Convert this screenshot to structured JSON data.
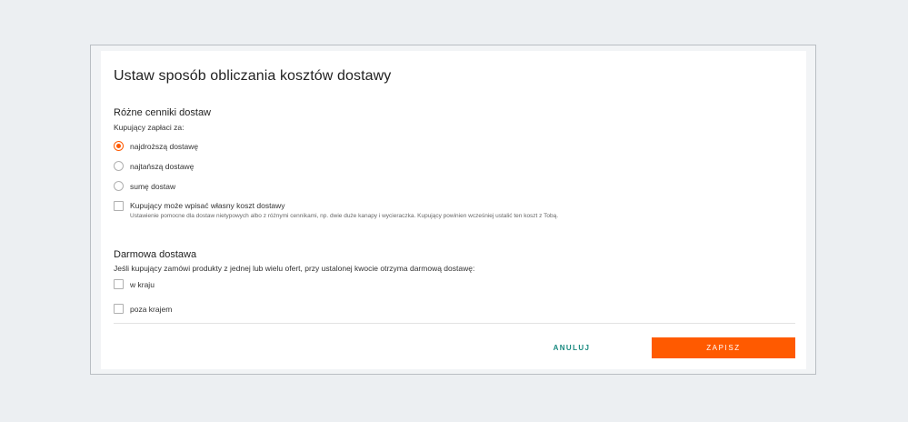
{
  "dialog": {
    "title": "Ustaw sposób obliczania kosztów dostawy"
  },
  "pricing": {
    "heading": "Różne cenniki dostaw",
    "subheading": "Kupujący zapłaci za:",
    "options": [
      {
        "label": "najdroższą dostawę",
        "selected": true
      },
      {
        "label": "najtańszą dostawę",
        "selected": false
      },
      {
        "label": "sumę dostaw",
        "selected": false
      }
    ],
    "custom_cost": {
      "label": "Kupujący może wpisać własny koszt dostawy",
      "help": "Ustawienie pomocne dla dostaw nietypowych albo z różnymi cennikami, np. dwie duże kanapy i wycieraczka. Kupujący powinien wcześniej ustalić ten koszt z Tobą.",
      "checked": false
    }
  },
  "free_shipping": {
    "heading": "Darmowa dostawa",
    "subheading": "Jeśli kupujący zamówi produkty z jednej lub wielu ofert, przy ustalonej kwocie otrzyma darmową dostawę:",
    "options": [
      {
        "label": "w kraju",
        "checked": false
      },
      {
        "label": "poza krajem",
        "checked": false
      }
    ]
  },
  "footer": {
    "cancel_label": "ANULUJ",
    "save_label": "ZAPISZ"
  },
  "colors": {
    "accent": "#ff5a00",
    "link": "#1a8a80",
    "background": "#eceff2"
  }
}
